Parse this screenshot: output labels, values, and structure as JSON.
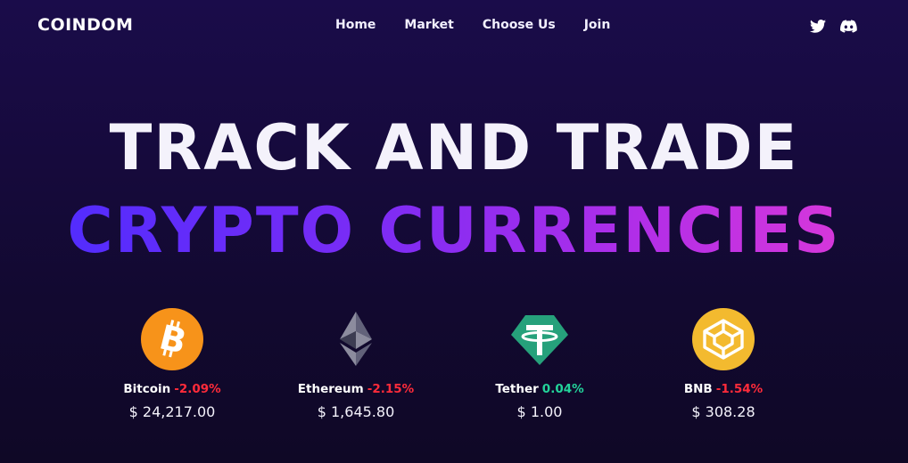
{
  "nav": {
    "logo": "COINDOM",
    "links": [
      "Home",
      "Market",
      "Choose Us",
      "Join"
    ],
    "socials": [
      "twitter-icon",
      "discord-icon"
    ]
  },
  "hero": {
    "line1": "TRACK AND TRADE",
    "line2": "CRYPTO CURRENCIES"
  },
  "coins": [
    {
      "name": "Bitcoin",
      "change": "-2.09%",
      "price": "$ 24,217.00",
      "icon": "bitcoin-icon",
      "color": "#f7931a"
    },
    {
      "name": "Ethereum",
      "change": "-2.15%",
      "price": "$ 1,645.80",
      "icon": "ethereum-icon",
      "color": "#8c8c9e"
    },
    {
      "name": "Tether",
      "change": "0.04%",
      "price": "$ 1.00",
      "icon": "tether-icon",
      "color": "#26a17b"
    },
    {
      "name": "BNB",
      "change": "-1.54%",
      "price": "$ 308.28",
      "icon": "bnb-icon",
      "color": "#f3ba2f"
    }
  ],
  "colors": {
    "negative": "#ff2b3a",
    "positive": "#23d39a",
    "gradient_start": "#4a2cff",
    "gradient_end": "#e23ad6"
  }
}
